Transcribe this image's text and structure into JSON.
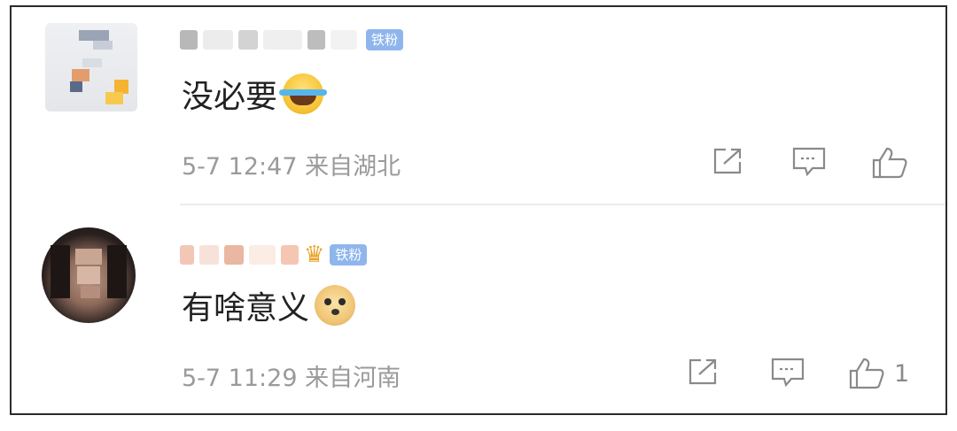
{
  "comments": [
    {
      "badge": "铁粉",
      "text": "没必要",
      "emoji": "laughing-tears-emoji",
      "time": "5-7 12:47",
      "location": "来自湖北",
      "likes": ""
    },
    {
      "badge": "铁粉",
      "text": "有啥意义",
      "emoji": "doge-emoji",
      "time": "5-7 11:29",
      "location": "来自河南",
      "likes": "1"
    }
  ],
  "colors": {
    "badge": "#8fb6ec",
    "meta": "#9a9a9a",
    "text": "#222222",
    "icon": "#8a8a8a"
  },
  "icons": [
    "share-icon",
    "reply-icon",
    "like-icon",
    "crown-icon"
  ]
}
